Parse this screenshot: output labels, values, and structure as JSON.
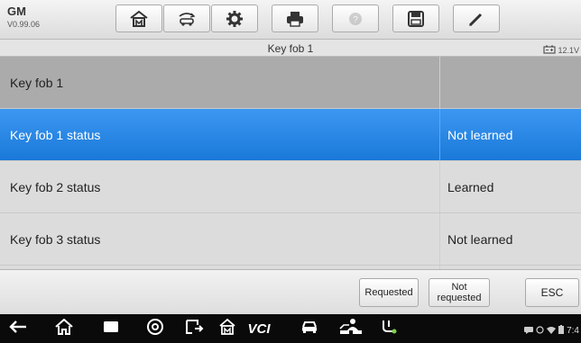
{
  "app": {
    "make": "GM",
    "version": "V0.99.06"
  },
  "toolbar": {
    "buttons": [
      {
        "icon": "home-icon"
      },
      {
        "icon": "vehicle-swap-icon"
      },
      {
        "icon": "settings-icon"
      },
      {
        "icon": "print-icon"
      },
      {
        "icon": "help-icon"
      },
      {
        "icon": "save-icon"
      },
      {
        "icon": "edit-icon"
      }
    ]
  },
  "title_bar": {
    "title": "Key fob 1",
    "voltage": "12.1V"
  },
  "table": {
    "rows": [
      {
        "label": "Key fob 1",
        "value": "",
        "kind": "header"
      },
      {
        "label": "Key fob 1 status",
        "value": "Not learned",
        "kind": "selected"
      },
      {
        "label": "Key fob 2 status",
        "value": "Learned",
        "kind": "plain"
      },
      {
        "label": "Key fob 3 status",
        "value": "Not learned",
        "kind": "plain"
      }
    ]
  },
  "actions": {
    "requested": "Requested",
    "not_requested_line1": "Not",
    "not_requested_line2": "requested",
    "esc": "ESC"
  },
  "navbar": {
    "vcl_label": "VCI",
    "clock": "7:4"
  },
  "colors": {
    "selected_row": "#2787e6",
    "header_row": "#ababab",
    "plain_row": "#dcdcdc"
  }
}
